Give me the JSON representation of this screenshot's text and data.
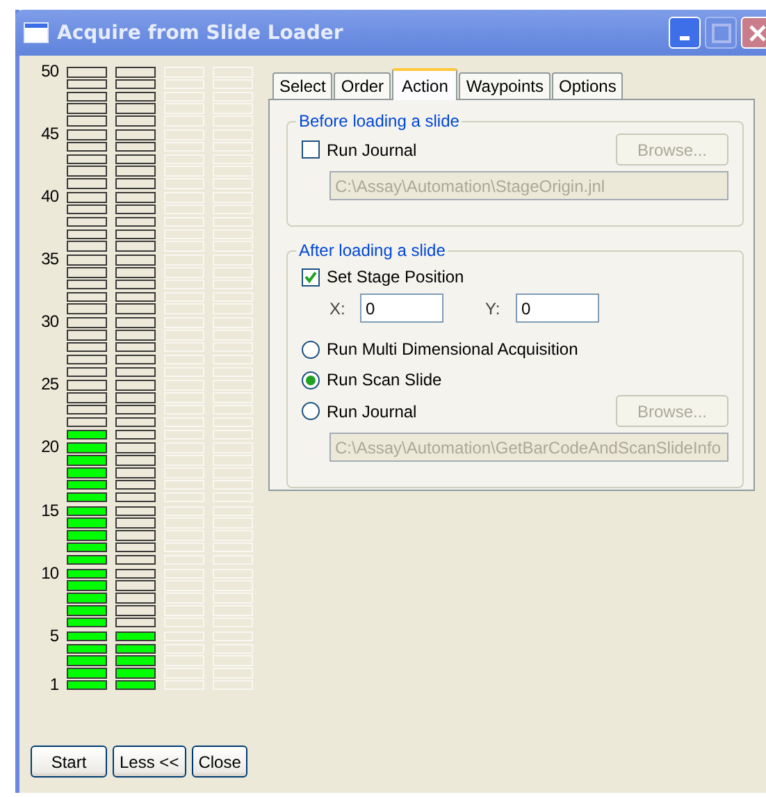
{
  "window": {
    "title": "Acquire from Slide Loader"
  },
  "slot_labels": [
    "50",
    "45",
    "40",
    "35",
    "30",
    "25",
    "20",
    "15",
    "10",
    "5",
    "1"
  ],
  "slot_columns": [
    {
      "disabled": false,
      "slots": [
        {
          "filled": false
        },
        {
          "filled": false
        },
        {
          "filled": false
        },
        {
          "filled": false
        },
        {
          "filled": false
        },
        {
          "filled": false
        },
        {
          "filled": false
        },
        {
          "filled": false
        },
        {
          "filled": false
        },
        {
          "filled": false
        },
        {
          "filled": false
        },
        {
          "filled": false
        },
        {
          "filled": false
        },
        {
          "filled": false
        },
        {
          "filled": false
        },
        {
          "filled": false
        },
        {
          "filled": false
        },
        {
          "filled": false
        },
        {
          "filled": false
        },
        {
          "filled": false
        },
        {
          "filled": false
        },
        {
          "filled": false
        },
        {
          "filled": false
        },
        {
          "filled": false
        },
        {
          "filled": false
        },
        {
          "filled": false
        },
        {
          "filled": false
        },
        {
          "filled": false
        },
        {
          "filled": false
        },
        {
          "filled": true
        },
        {
          "filled": true
        },
        {
          "filled": true
        },
        {
          "filled": true
        },
        {
          "filled": true
        },
        {
          "filled": true
        },
        {
          "filled": true
        },
        {
          "filled": true
        },
        {
          "filled": true
        },
        {
          "filled": true
        },
        {
          "filled": true
        },
        {
          "filled": true
        },
        {
          "filled": true
        },
        {
          "filled": true
        },
        {
          "filled": true
        },
        {
          "filled": true
        },
        {
          "filled": true
        },
        {
          "filled": true
        },
        {
          "filled": true
        },
        {
          "filled": true
        },
        {
          "filled": true
        }
      ]
    },
    {
      "disabled": false,
      "slots": [
        {
          "filled": false
        },
        {
          "filled": false
        },
        {
          "filled": false
        },
        {
          "filled": false
        },
        {
          "filled": false
        },
        {
          "filled": false
        },
        {
          "filled": false
        },
        {
          "filled": false
        },
        {
          "filled": false
        },
        {
          "filled": false
        },
        {
          "filled": false
        },
        {
          "filled": false
        },
        {
          "filled": false
        },
        {
          "filled": false
        },
        {
          "filled": false
        },
        {
          "filled": false
        },
        {
          "filled": false
        },
        {
          "filled": false
        },
        {
          "filled": false
        },
        {
          "filled": false
        },
        {
          "filled": false
        },
        {
          "filled": false
        },
        {
          "filled": false
        },
        {
          "filled": false
        },
        {
          "filled": false
        },
        {
          "filled": false
        },
        {
          "filled": false
        },
        {
          "filled": false
        },
        {
          "filled": false
        },
        {
          "filled": false
        },
        {
          "filled": false
        },
        {
          "filled": false
        },
        {
          "filled": false
        },
        {
          "filled": false
        },
        {
          "filled": false
        },
        {
          "filled": false
        },
        {
          "filled": false
        },
        {
          "filled": false
        },
        {
          "filled": false
        },
        {
          "filled": false
        },
        {
          "filled": false
        },
        {
          "filled": false
        },
        {
          "filled": false
        },
        {
          "filled": false
        },
        {
          "filled": false
        },
        {
          "filled": true
        },
        {
          "filled": true
        },
        {
          "filled": true
        },
        {
          "filled": true
        },
        {
          "filled": true
        }
      ]
    },
    {
      "disabled": true,
      "slots": [
        {
          "filled": false
        },
        {
          "filled": false
        },
        {
          "filled": false
        },
        {
          "filled": false
        },
        {
          "filled": false
        },
        {
          "filled": false
        },
        {
          "filled": false
        },
        {
          "filled": false
        },
        {
          "filled": false
        },
        {
          "filled": false
        },
        {
          "filled": false
        },
        {
          "filled": false
        },
        {
          "filled": false
        },
        {
          "filled": false
        },
        {
          "filled": false
        },
        {
          "filled": false
        },
        {
          "filled": false
        },
        {
          "filled": false
        },
        {
          "filled": false
        },
        {
          "filled": false
        },
        {
          "filled": false
        },
        {
          "filled": false
        },
        {
          "filled": false
        },
        {
          "filled": false
        },
        {
          "filled": false
        },
        {
          "filled": false
        },
        {
          "filled": false
        },
        {
          "filled": false
        },
        {
          "filled": false
        },
        {
          "filled": false
        },
        {
          "filled": false
        },
        {
          "filled": false
        },
        {
          "filled": false
        },
        {
          "filled": false
        },
        {
          "filled": false
        },
        {
          "filled": false
        },
        {
          "filled": false
        },
        {
          "filled": false
        },
        {
          "filled": false
        },
        {
          "filled": false
        },
        {
          "filled": false
        },
        {
          "filled": false
        },
        {
          "filled": false
        },
        {
          "filled": false
        },
        {
          "filled": false
        },
        {
          "filled": false
        },
        {
          "filled": false
        },
        {
          "filled": false
        },
        {
          "filled": false
        },
        {
          "filled": false
        }
      ]
    },
    {
      "disabled": true,
      "slots": [
        {
          "filled": false
        },
        {
          "filled": false
        },
        {
          "filled": false
        },
        {
          "filled": false
        },
        {
          "filled": false
        },
        {
          "filled": false
        },
        {
          "filled": false
        },
        {
          "filled": false
        },
        {
          "filled": false
        },
        {
          "filled": false
        },
        {
          "filled": false
        },
        {
          "filled": false
        },
        {
          "filled": false
        },
        {
          "filled": false
        },
        {
          "filled": false
        },
        {
          "filled": false
        },
        {
          "filled": false
        },
        {
          "filled": false
        },
        {
          "filled": false
        },
        {
          "filled": false
        },
        {
          "filled": false
        },
        {
          "filled": false
        },
        {
          "filled": false
        },
        {
          "filled": false
        },
        {
          "filled": false
        },
        {
          "filled": false
        },
        {
          "filled": false
        },
        {
          "filled": false
        },
        {
          "filled": false
        },
        {
          "filled": false
        },
        {
          "filled": false
        },
        {
          "filled": false
        },
        {
          "filled": false
        },
        {
          "filled": false
        },
        {
          "filled": false
        },
        {
          "filled": false
        },
        {
          "filled": false
        },
        {
          "filled": false
        },
        {
          "filled": false
        },
        {
          "filled": false
        },
        {
          "filled": false
        },
        {
          "filled": false
        },
        {
          "filled": false
        },
        {
          "filled": false
        },
        {
          "filled": false
        },
        {
          "filled": false
        },
        {
          "filled": false
        },
        {
          "filled": false
        },
        {
          "filled": false
        },
        {
          "filled": false
        }
      ]
    }
  ],
  "buttons": [
    "Start",
    "Less <<",
    "Close"
  ],
  "tabs": [
    {
      "label": "Select",
      "selected": false
    },
    {
      "label": "Order",
      "selected": false
    },
    {
      "label": "Action",
      "selected": true
    },
    {
      "label": "Waypoints",
      "selected": false
    },
    {
      "label": "Options",
      "selected": false
    }
  ],
  "before_group": {
    "title": "Before loading a slide",
    "run_journal": {
      "label": "Run Journal",
      "checked": false
    },
    "browse": "Browse...",
    "path": "C:\\Assay\\Automation\\StageOrigin.jnl"
  },
  "after_group": {
    "title": "After loading a slide",
    "set_stage": {
      "label": "Set Stage Position",
      "checked": true
    },
    "x_label": "X:",
    "x_value": "0",
    "y_label": "Y:",
    "y_value": "0",
    "options": [
      {
        "label": "Run Multi Dimensional Acquisition",
        "selected": false
      },
      {
        "label": "Run Scan Slide",
        "selected": true
      },
      {
        "label": "Run Journal",
        "selected": false
      }
    ],
    "browse": "Browse...",
    "path": "C:\\Assay\\Automation\\GetBarCodeAndScanSlideInfo"
  }
}
